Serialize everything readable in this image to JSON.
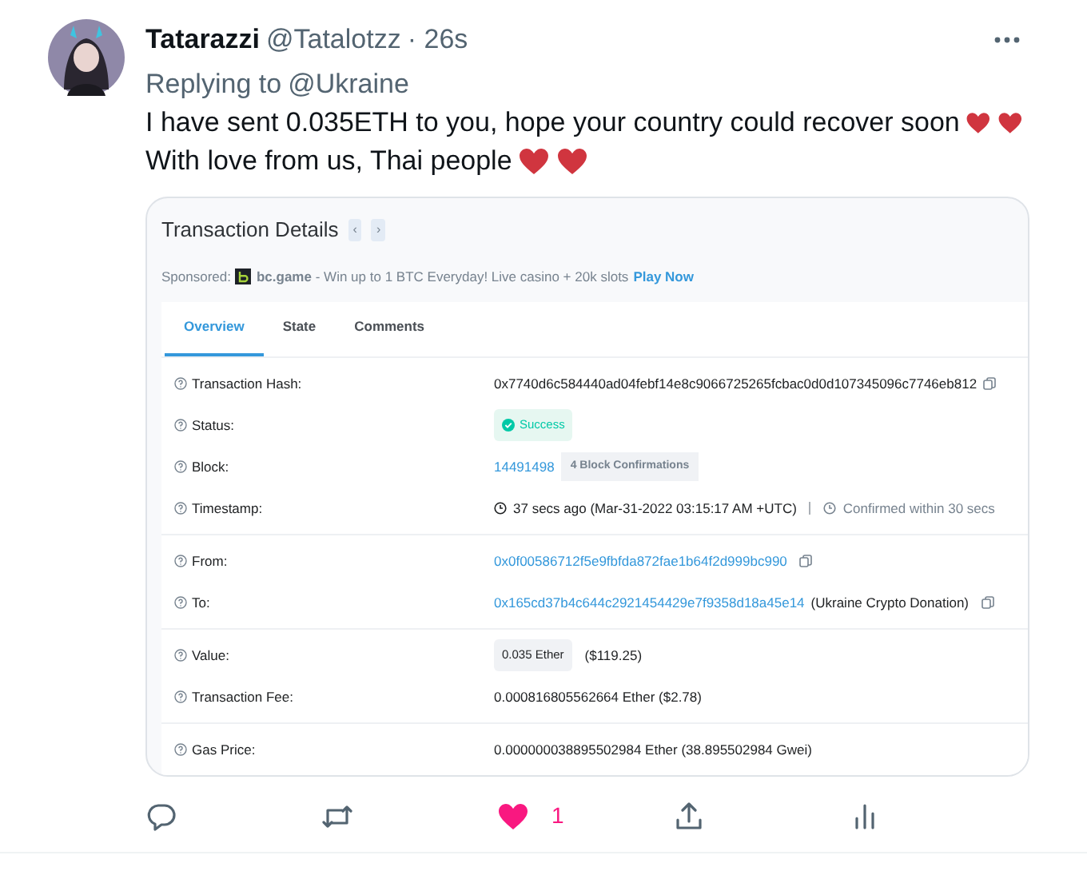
{
  "tweet": {
    "name": "Tatarazzi",
    "handle": "@Tatalotzz",
    "time": "· 26s",
    "reply_prefix": "Replying to",
    "reply_to": "@Ukraine",
    "lines": [
      {
        "text": "I have sent 0.035ETH to you, hope your country could recover soon",
        "icons": [
          {
            "kind": "heart"
          },
          {
            "kind": "heart"
          }
        ]
      },
      {
        "text": "With love from us, Thai people",
        "icons": [
          {
            "kind": "heart"
          },
          {
            "kind": "heart"
          }
        ]
      }
    ]
  },
  "embed": {
    "title": "Transaction Details",
    "nav": [
      "‹",
      "›"
    ],
    "sponsor": {
      "label": "Sponsored:",
      "brand": "bc.game",
      "text": "- Win up to 1 BTC Everyday! Live casino + 20k slots",
      "link": "Play Now"
    },
    "tabs": [
      {
        "label": "Overview",
        "selected": true
      },
      {
        "label": "State",
        "selected": false
      },
      {
        "label": "Comments",
        "selected": false
      }
    ],
    "sections": [
      [
        {
          "kind": "copy",
          "label": "Transaction Hash:",
          "value": "0x7740d6c584440ad04febf14e8c9066725265fcbac0d0d107345096c7746eb812"
        },
        {
          "kind": "status",
          "label": "Status:",
          "badge": "Success"
        },
        {
          "kind": "block",
          "label": "Block:",
          "link": "14491498",
          "badge": "4 Block Confirmations"
        },
        {
          "kind": "timestamp",
          "label": "Timestamp:",
          "value": "37 secs ago (Mar-31-2022 03:15:17 AM +UTC)",
          "note": "Confirmed within 30 secs"
        }
      ],
      [
        {
          "kind": "address",
          "label": "From:",
          "link": "0x0f00586712f5e9fbfda872fae1b64f2d999bc990"
        },
        {
          "kind": "address",
          "label": "To:",
          "link": "0x165cd37b4c644c2921454429e7f9358d18a45e14",
          "note": "(Ukraine Crypto Donation)"
        }
      ],
      [
        {
          "kind": "value",
          "label": "Value:",
          "badge": "0.035 Ether",
          "value": "($119.25)"
        },
        {
          "kind": "plain",
          "label": "Transaction Fee:",
          "value": "0.000816805562664 Ether ($2.78)"
        }
      ],
      [
        {
          "kind": "plain",
          "label": "Gas Price:",
          "value": "0.000000038895502984 Ether (38.895502984 Gwei)"
        }
      ]
    ]
  },
  "actions": [
    {
      "kind": "reply"
    },
    {
      "kind": "retweet"
    },
    {
      "kind": "like",
      "liked": true,
      "count": "1"
    },
    {
      "kind": "share"
    },
    {
      "kind": "stats"
    }
  ]
}
